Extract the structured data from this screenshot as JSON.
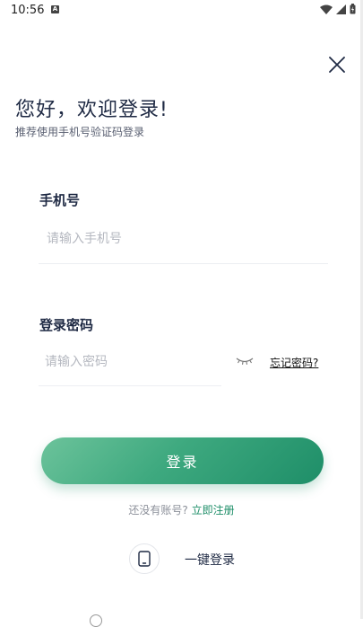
{
  "status_bar": {
    "time": "10:56",
    "badge": "A"
  },
  "close_icon": "close-icon",
  "greeting": "您好，欢迎登录!",
  "subtitle": "推荐使用手机号验证码登录",
  "phone": {
    "label": "手机号",
    "placeholder": "请输入手机号",
    "value": ""
  },
  "password": {
    "label": "登录密码",
    "placeholder": "请输入密码",
    "value": ""
  },
  "forgot_password": "忘记密码?",
  "login_button": "登录",
  "register": {
    "prompt": "还没有账号?",
    "link": "立即注册"
  },
  "one_key_login": {
    "label": "一键登录",
    "icon": "phone-icon"
  },
  "colors": {
    "accent": "#1e8e68",
    "accent_light": "#6cc39b",
    "text": "#1f2a44"
  }
}
